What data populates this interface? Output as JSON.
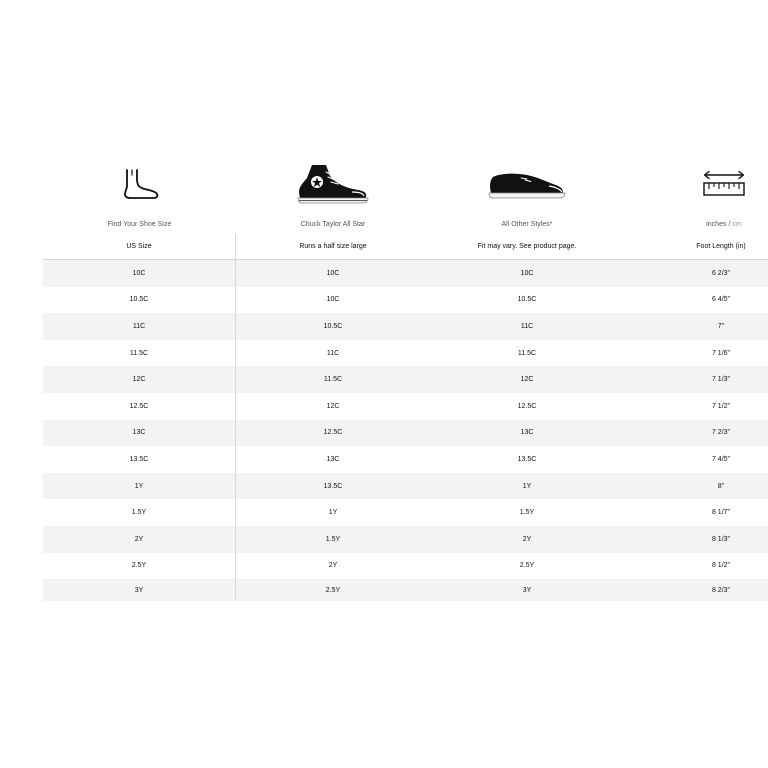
{
  "columns": [
    {
      "caption": "Find Your Shoe Size",
      "header": "US Size",
      "icon": "foot-icon"
    },
    {
      "caption": "Chuck Taylor All Star",
      "header": "Runs a half size large",
      "icon": "high-top-sneaker-icon"
    },
    {
      "caption": "All Other Styles*",
      "header": "Fit may vary. See product page.",
      "icon": "low-top-sneaker-icon"
    },
    {
      "caption": "",
      "header": "Foot Length (in)",
      "icon": "ruler-measure-icon"
    }
  ],
  "units": {
    "inches": "inches",
    "separator": "/",
    "cm": "cm"
  },
  "rows": [
    [
      "10C",
      "10C",
      "10C",
      "6 2/3\""
    ],
    [
      "10.5C",
      "10C",
      "10.5C",
      "6 4/5\""
    ],
    [
      "11C",
      "10.5C",
      "11C",
      "7\""
    ],
    [
      "11.5C",
      "11C",
      "11.5C",
      "7 1/6\""
    ],
    [
      "12C",
      "11.5C",
      "12C",
      "7 1/3\""
    ],
    [
      "12.5C",
      "12C",
      "12.5C",
      "7 1/2\""
    ],
    [
      "13C",
      "12.5C",
      "13C",
      "7 2/3\""
    ],
    [
      "13.5C",
      "13C",
      "13.5C",
      "7 4/5\""
    ],
    [
      "1Y",
      "13.5C",
      "1Y",
      "8\""
    ],
    [
      "1.5Y",
      "1Y",
      "1.5Y",
      "8 1/7\""
    ],
    [
      "2Y",
      "1.5Y",
      "2Y",
      "8 1/3\""
    ],
    [
      "2.5Y",
      "2Y",
      "2.5Y",
      "8 1/2\""
    ],
    [
      "3Y",
      "2.5Y",
      "3Y",
      "8 2/3\""
    ]
  ]
}
